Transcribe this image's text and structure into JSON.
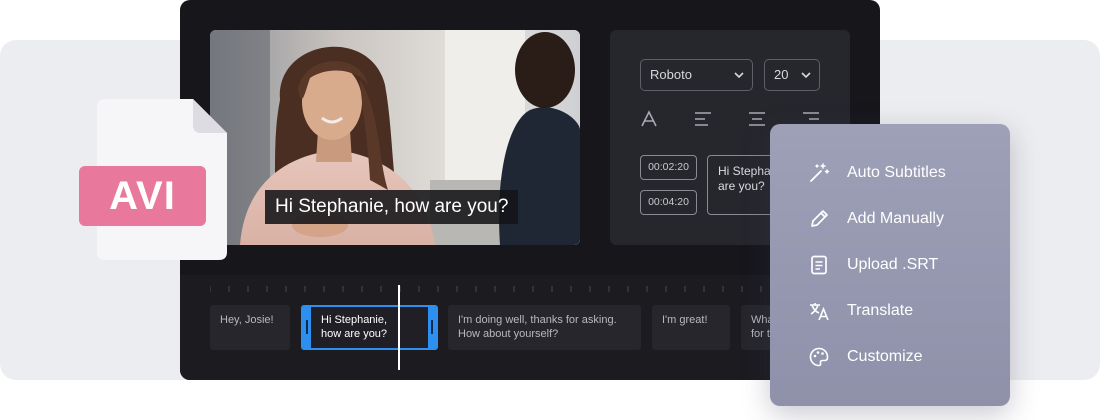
{
  "video": {
    "caption": "Hi Stephanie, how are you?"
  },
  "settings": {
    "font_select": "Roboto",
    "size_select": "20",
    "tools": [
      "text-style-icon",
      "align-left-icon",
      "align-center-icon",
      "align-right-icon"
    ],
    "timestamps": [
      "00:02:20",
      "00:04:20"
    ],
    "subtitle_text": "Hi Stephanie, how are you?"
  },
  "timeline": {
    "clips": [
      {
        "line1": "Hey, Josie!",
        "line2": ""
      },
      {
        "line1": "Hi Stephanie,",
        "line2": "how are you?"
      },
      {
        "line1": "I'm doing well, thanks for asking.",
        "line2": "How about yourself?"
      },
      {
        "line1": "I'm great!",
        "line2": ""
      },
      {
        "line1": "What",
        "line2": "for t"
      }
    ]
  },
  "file": {
    "format": "AVI"
  },
  "menu": {
    "items": [
      {
        "label": "Auto Subtitles",
        "icon": "magic-wand-icon"
      },
      {
        "label": "Add Manually",
        "icon": "pencil-icon"
      },
      {
        "label": "Upload .SRT",
        "icon": "document-icon"
      },
      {
        "label": "Translate",
        "icon": "translate-icon"
      },
      {
        "label": "Customize",
        "icon": "palette-icon"
      }
    ]
  },
  "colors": {
    "accent": "#2d8ff0",
    "avi_badge": "#e8799c",
    "editor_bg": "#16161b",
    "menu_bg": "#9ea0b8"
  }
}
